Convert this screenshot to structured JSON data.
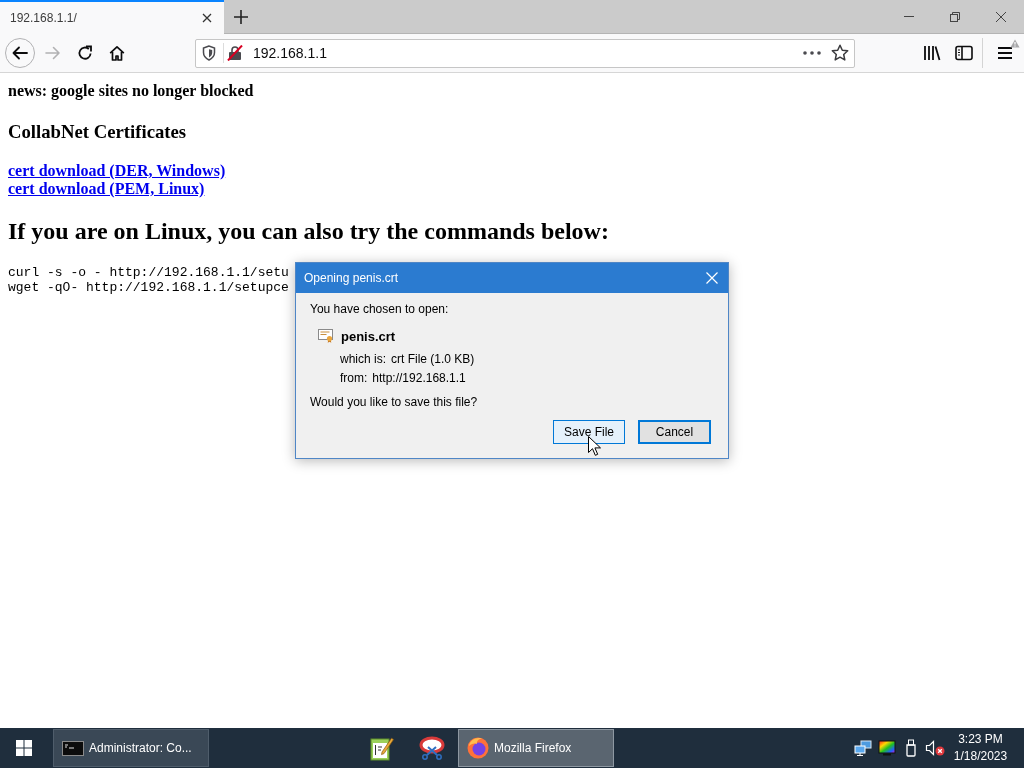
{
  "browser": {
    "tabs": [
      {
        "title": "192.168.1.1/",
        "selected": true
      }
    ],
    "back_disabled": false,
    "forward_disabled": true,
    "url": "192.168.1.1",
    "menu_alert": true
  },
  "page": {
    "news": "news: google sites no longer blocked",
    "heading": "CollabNet Certificates",
    "links": [
      "cert download (DER, Windows)",
      "cert download (PEM, Linux)"
    ],
    "subheading": "If you are on Linux, you can also try the commands below:",
    "commands": [
      "curl -s -o - http://192.168.1.1/setu",
      "wget -qO- http://192.168.1.1/setupce"
    ]
  },
  "dialog": {
    "title": "Opening penis.crt",
    "intro": "You have chosen to open:",
    "file_name": "penis.crt",
    "details": [
      {
        "label": "which is:",
        "value": "crt File (1.0 KB)"
      },
      {
        "label": "from:",
        "value": "http://192.168.1.1"
      }
    ],
    "question": "Would you like to save this file?",
    "buttons": [
      {
        "label": "Save File",
        "hovered": true,
        "default": false
      },
      {
        "label": "Cancel",
        "hovered": false,
        "default": true
      }
    ]
  },
  "taskbar": {
    "items": [
      {
        "kind": "window",
        "label": "Administrator: Co...",
        "selected": false
      },
      {
        "kind": "pinned",
        "selected": false
      },
      {
        "kind": "pinned",
        "selected": false
      },
      {
        "kind": "window",
        "label": "Mozilla Firefox",
        "selected": true
      }
    ],
    "volume_muted": true,
    "clock": {
      "time": "3:23 PM",
      "date": "1/18/2023"
    }
  }
}
